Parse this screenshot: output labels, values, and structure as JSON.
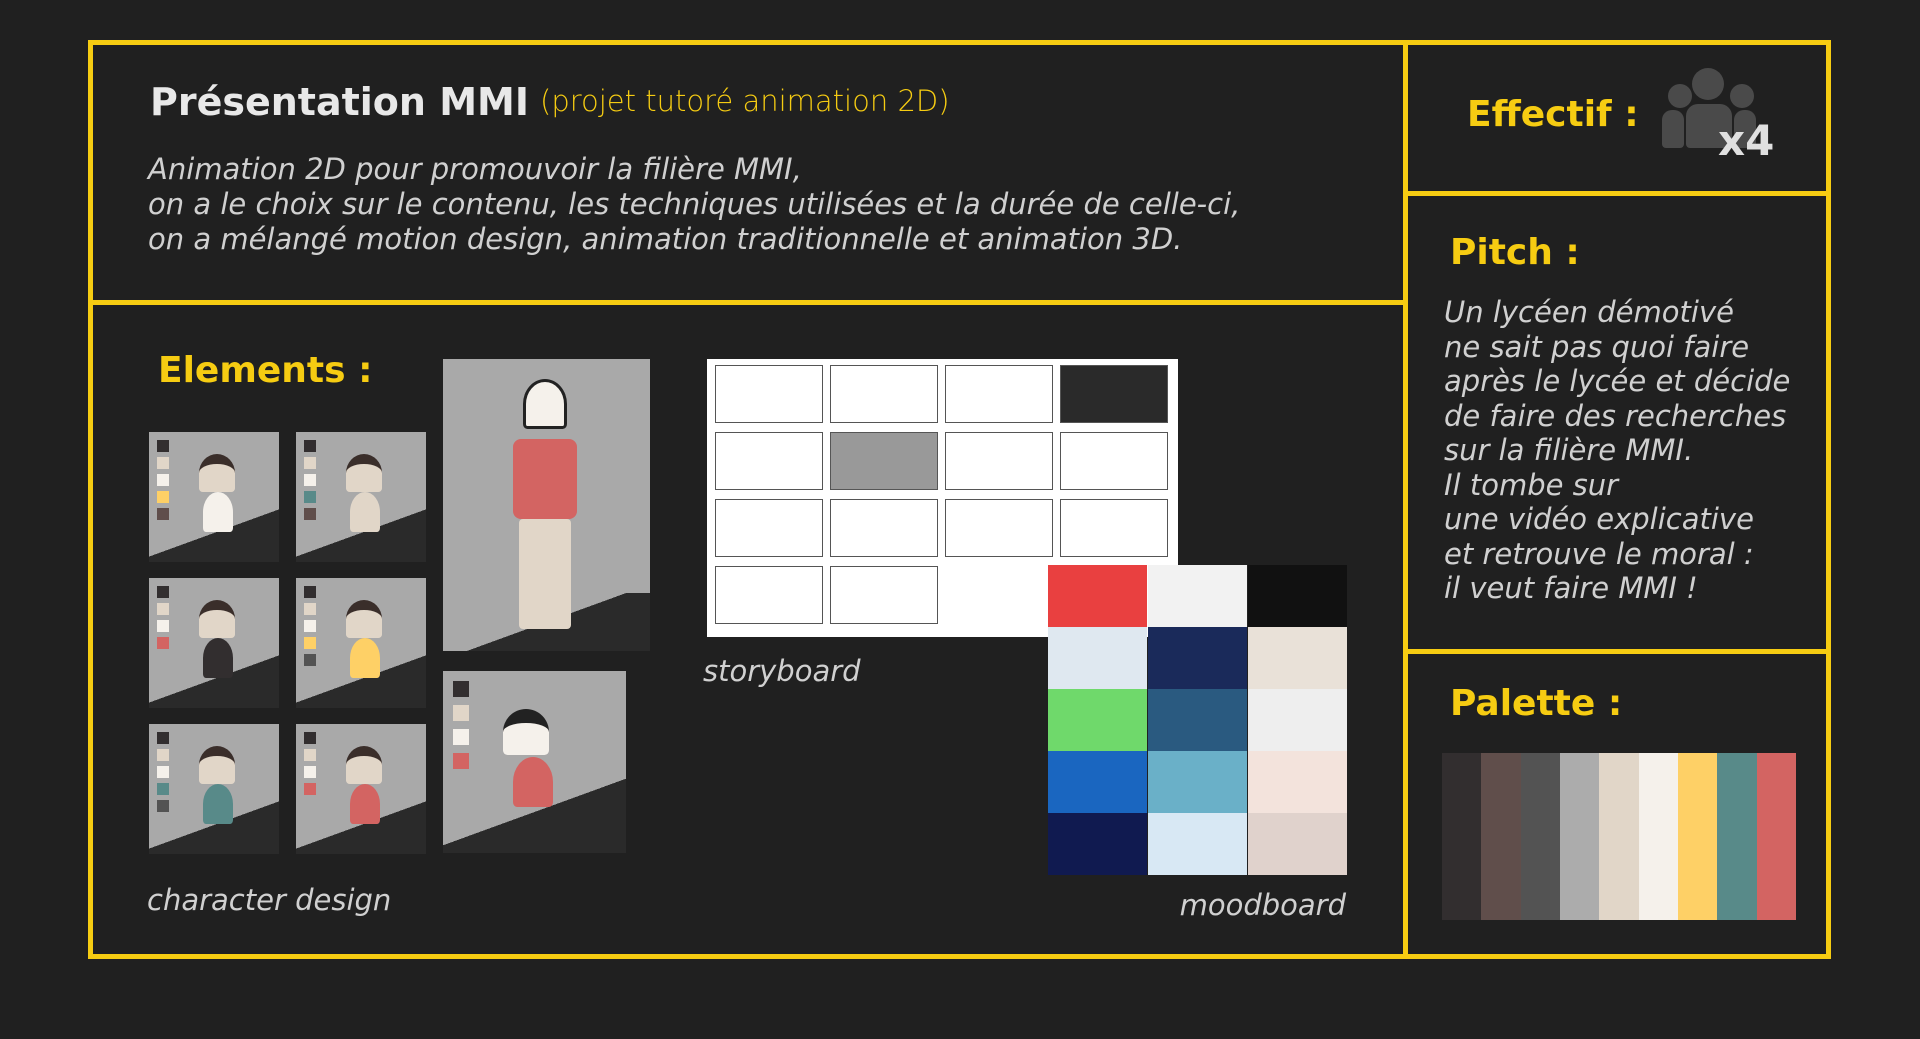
{
  "header": {
    "title": "Présentation MMI",
    "subtitle": "(projet tutoré animation 2D)",
    "description": [
      "Animation 2D pour promouvoir la filière MMI,",
      "on a le choix sur le contenu, les techniques utilisées et la durée de celle-ci,",
      "on a mélangé motion design, animation traditionnelle et animation 3D."
    ]
  },
  "elements": {
    "title": "Elements :",
    "character_label": "character design",
    "storyboard_label": "storyboard",
    "moodboard_label": "moodboard"
  },
  "effectif": {
    "title": "Effectif :",
    "icon": "group-icon",
    "count": "x4"
  },
  "pitch": {
    "title": "Pitch :",
    "lines": [
      "Un lycéen démotivé",
      "ne sait pas quoi faire",
      "après le lycée et décide",
      "de faire des recherches",
      "sur la filière MMI.",
      "Il tombe sur",
      "une vidéo explicative",
      "et retrouve le moral :",
      "il veut faire MMI !"
    ]
  },
  "palette": {
    "title": "Palette :",
    "colors": [
      "#322e2f",
      "#604e4b",
      "#535353",
      "#acacac",
      "#e1d6c8",
      "#f5f1eb",
      "#fed066",
      "#588a89",
      "#d36462"
    ]
  },
  "colors": {
    "accent": "#f6cc12",
    "background": "#202020"
  }
}
